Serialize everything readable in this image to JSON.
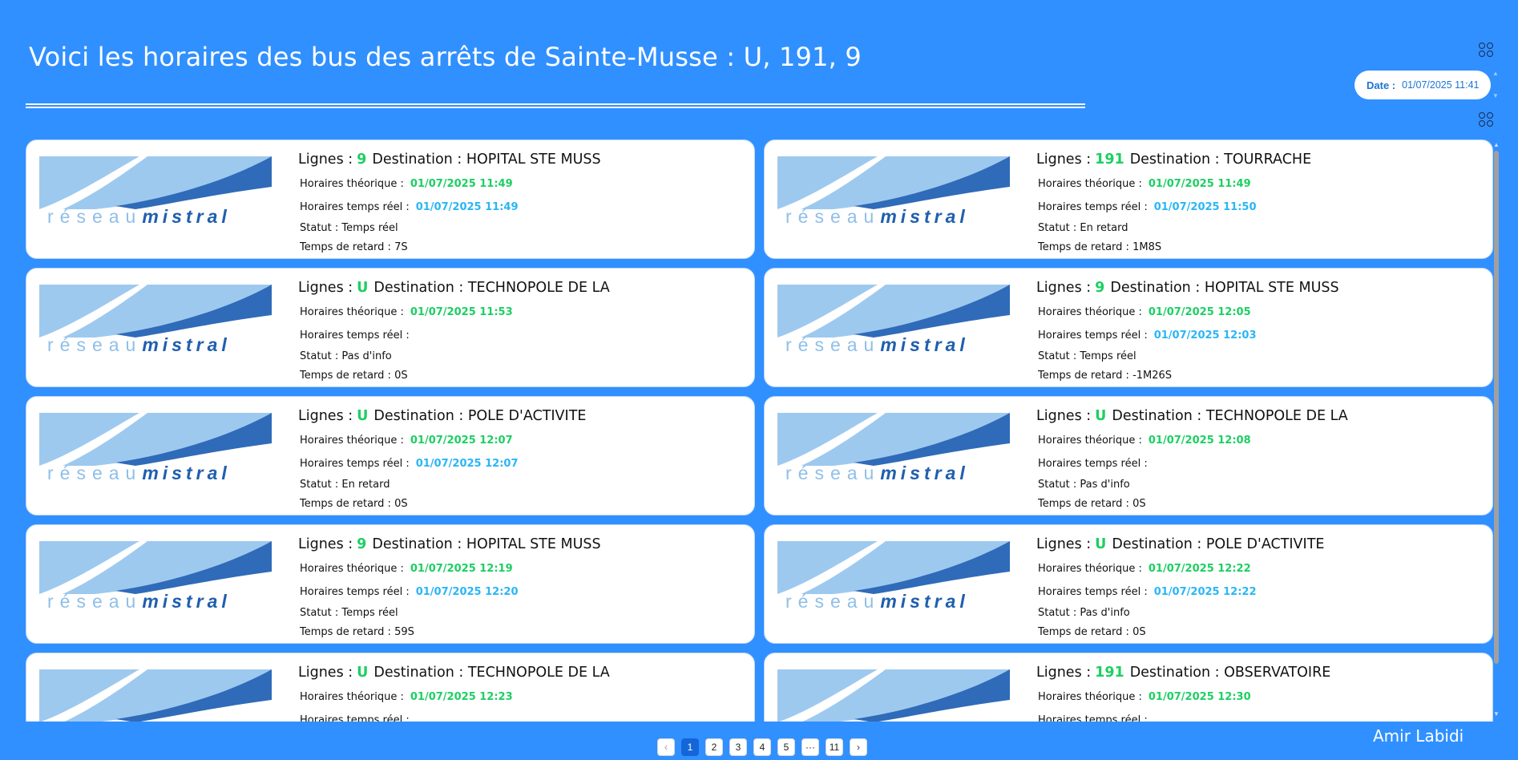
{
  "header": {
    "title": "Voici les horaires des bus des arrêts de Sainte-Musse : U, 191, 9",
    "date_label": "Date :",
    "date_value": "01/07/2025 11:41"
  },
  "labels": {
    "lignes": "Lignes :",
    "destination": "Destination :",
    "theorique": "Horaires théorique :",
    "temps_reel": "Horaires temps réel :",
    "statut": "Statut :",
    "retard": "Temps de retard :"
  },
  "logo": {
    "part1": "réseau",
    "part2": "mistral"
  },
  "cards": [
    {
      "line": "9",
      "destination": "HOPITAL STE MUSS",
      "theorique": "01/07/2025 11:49",
      "reel": "01/07/2025 11:49",
      "statut": "Temps réel",
      "retard": "7S"
    },
    {
      "line": "191",
      "destination": "TOURRACHE",
      "theorique": "01/07/2025 11:49",
      "reel": "01/07/2025 11:50",
      "statut": "En retard",
      "retard": "1M8S"
    },
    {
      "line": "U",
      "destination": "TECHNOPOLE DE LA",
      "theorique": "01/07/2025 11:53",
      "reel": "",
      "statut": "Pas d'info",
      "retard": "0S"
    },
    {
      "line": "9",
      "destination": "HOPITAL STE MUSS",
      "theorique": "01/07/2025 12:05",
      "reel": "01/07/2025 12:03",
      "statut": "Temps réel",
      "retard": "-1M26S"
    },
    {
      "line": "U",
      "destination": "POLE D'ACTIVITE",
      "theorique": "01/07/2025 12:07",
      "reel": "01/07/2025 12:07",
      "statut": "En retard",
      "retard": "0S"
    },
    {
      "line": "U",
      "destination": "TECHNOPOLE DE LA",
      "theorique": "01/07/2025 12:08",
      "reel": "",
      "statut": "Pas d'info",
      "retard": "0S"
    },
    {
      "line": "9",
      "destination": "HOPITAL STE MUSS",
      "theorique": "01/07/2025 12:19",
      "reel": "01/07/2025 12:20",
      "statut": "Temps réel",
      "retard": "59S"
    },
    {
      "line": "U",
      "destination": "POLE D'ACTIVITE",
      "theorique": "01/07/2025 12:22",
      "reel": "01/07/2025 12:22",
      "statut": "Pas d'info",
      "retard": "0S"
    },
    {
      "line": "U",
      "destination": "TECHNOPOLE DE LA",
      "theorique": "01/07/2025 12:23",
      "reel": "",
      "statut": "",
      "retard": ""
    },
    {
      "line": "191",
      "destination": "OBSERVATOIRE",
      "theorique": "01/07/2025 12:30",
      "reel": "",
      "statut": "",
      "retard": ""
    }
  ],
  "pagination": {
    "prev": "‹",
    "pages": [
      "1",
      "2",
      "3",
      "4",
      "5",
      "···",
      "11"
    ],
    "active": "1",
    "next": "›"
  },
  "footer": {
    "author": "Amir Labidi"
  },
  "colors": {
    "background": "#3090ff",
    "line_number": "#1ccf62",
    "theorique_value": "#1ccf62",
    "reel_value": "#29b6f6",
    "active_page": "#1466d8"
  }
}
